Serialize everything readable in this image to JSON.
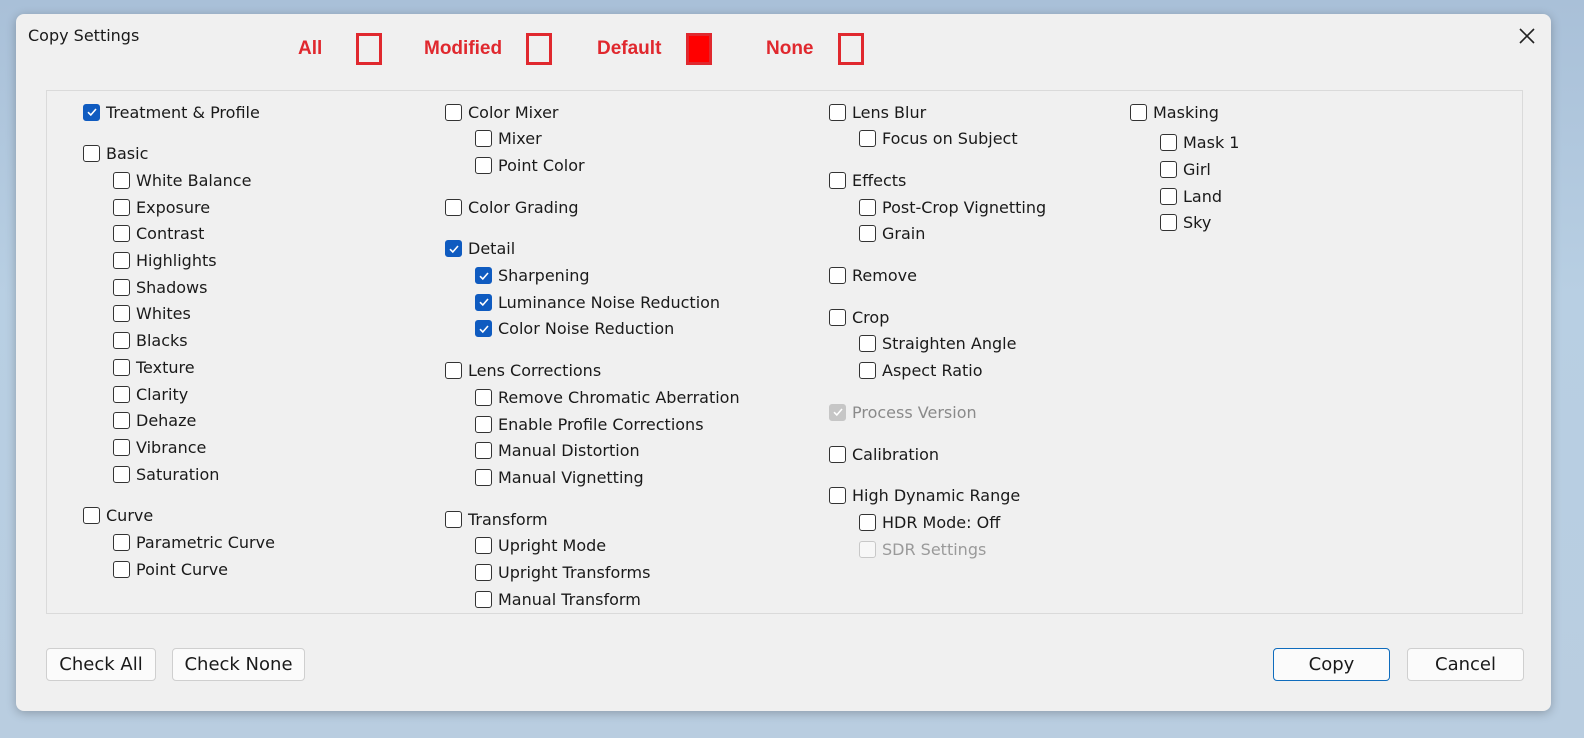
{
  "window": {
    "title": "Copy Settings"
  },
  "legend": {
    "items": [
      {
        "label": "All",
        "state": "empty"
      },
      {
        "label": "Modified",
        "state": "empty"
      },
      {
        "label": "Default",
        "state": "filled"
      },
      {
        "label": "None",
        "state": "empty"
      }
    ],
    "color": "#e0282e"
  },
  "columns": [
    {
      "groups": [
        {
          "label": "Treatment & Profile",
          "checked": true,
          "children": []
        },
        {
          "label": "Basic",
          "checked": false,
          "children": [
            {
              "label": "White Balance",
              "checked": false
            },
            {
              "label": "Exposure",
              "checked": false
            },
            {
              "label": "Contrast",
              "checked": false
            },
            {
              "label": "Highlights",
              "checked": false
            },
            {
              "label": "Shadows",
              "checked": false
            },
            {
              "label": "Whites",
              "checked": false
            },
            {
              "label": "Blacks",
              "checked": false
            },
            {
              "label": "Texture",
              "checked": false
            },
            {
              "label": "Clarity",
              "checked": false
            },
            {
              "label": "Dehaze",
              "checked": false
            },
            {
              "label": "Vibrance",
              "checked": false
            },
            {
              "label": "Saturation",
              "checked": false
            }
          ]
        },
        {
          "label": "Curve",
          "checked": false,
          "children": [
            {
              "label": "Parametric Curve",
              "checked": false
            },
            {
              "label": "Point Curve",
              "checked": false
            }
          ]
        }
      ]
    },
    {
      "groups": [
        {
          "label": "Color Mixer",
          "checked": false,
          "children": [
            {
              "label": "Mixer",
              "checked": false
            },
            {
              "label": "Point Color",
              "checked": false
            }
          ]
        },
        {
          "label": "Color Grading",
          "checked": false,
          "children": []
        },
        {
          "label": "Detail",
          "checked": true,
          "children": [
            {
              "label": "Sharpening",
              "checked": true
            },
            {
              "label": "Luminance Noise Reduction",
              "checked": true
            },
            {
              "label": "Color Noise Reduction",
              "checked": true
            }
          ]
        },
        {
          "label": "Lens Corrections",
          "checked": false,
          "children": [
            {
              "label": "Remove Chromatic Aberration",
              "checked": false
            },
            {
              "label": "Enable Profile Corrections",
              "checked": false
            },
            {
              "label": "Manual Distortion",
              "checked": false
            },
            {
              "label": "Manual Vignetting",
              "checked": false
            }
          ]
        },
        {
          "label": "Transform",
          "checked": false,
          "children": [
            {
              "label": "Upright Mode",
              "checked": false
            },
            {
              "label": "Upright Transforms",
              "checked": false
            },
            {
              "label": "Manual Transform",
              "checked": false
            }
          ]
        }
      ]
    },
    {
      "groups": [
        {
          "label": "Lens Blur",
          "checked": false,
          "children": [
            {
              "label": "Focus on Subject",
              "checked": false
            }
          ]
        },
        {
          "label": "Effects",
          "checked": false,
          "children": [
            {
              "label": "Post-Crop Vignetting",
              "checked": false
            },
            {
              "label": "Grain",
              "checked": false
            }
          ]
        },
        {
          "label": "Remove",
          "checked": false,
          "children": []
        },
        {
          "label": "Crop",
          "checked": false,
          "children": [
            {
              "label": "Straighten Angle",
              "checked": false
            },
            {
              "label": "Aspect Ratio",
              "checked": false
            }
          ]
        },
        {
          "label": "Process Version",
          "checked": true,
          "disabled": true,
          "children": []
        },
        {
          "label": "Calibration",
          "checked": false,
          "children": []
        },
        {
          "label": "High Dynamic Range",
          "checked": false,
          "children": [
            {
              "label": "HDR Mode: Off",
              "checked": false
            },
            {
              "label": "SDR Settings",
              "checked": false,
              "disabled": true
            }
          ]
        }
      ]
    },
    {
      "groups": [
        {
          "label": "Masking",
          "checked": false,
          "children": [
            {
              "label": "Mask 1",
              "checked": false
            },
            {
              "label": "Girl",
              "checked": false
            },
            {
              "label": "Land",
              "checked": false
            },
            {
              "label": "Sky",
              "checked": false
            }
          ]
        }
      ]
    }
  ],
  "buttons": {
    "check_all": "Check All",
    "check_none": "Check None",
    "copy": "Copy",
    "cancel": "Cancel"
  },
  "icons": {
    "close": "close-icon",
    "check": "check-icon"
  }
}
